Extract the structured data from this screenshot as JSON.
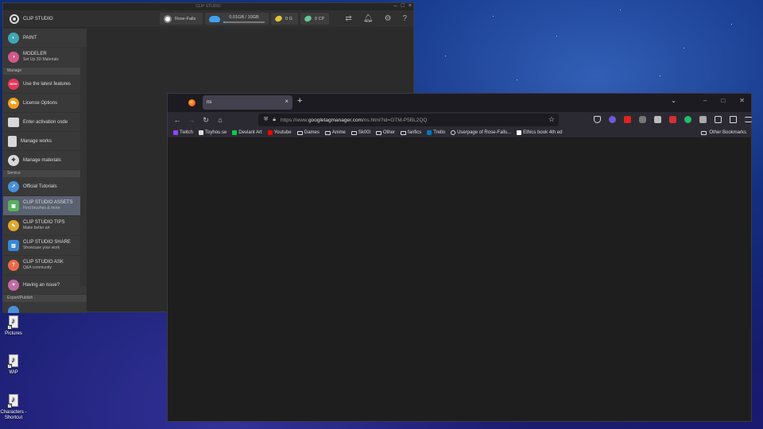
{
  "desktop": {
    "icons": [
      {
        "label": "Pictures"
      },
      {
        "label": "WIP"
      },
      {
        "label": "Characters - Shortcut"
      }
    ]
  },
  "clip": {
    "window_title": "CLIP STUDIO",
    "brand": "CLIP STUDIO",
    "user": "Rose-Falls",
    "storage": "0.01GB / 10GB",
    "storage_fraction": 0.04,
    "gold": "0 G",
    "cp": "0 CP",
    "sections": {
      "manage": "Manage",
      "service": "Service",
      "export": "Export/Publish"
    },
    "items": {
      "paint": "PAINT",
      "modeler": "MODELER",
      "modeler_sub": "Set Up 3D Materials",
      "latest": "Use the latest features",
      "license": "License Options",
      "activation": "Enter activation code",
      "works": "Manage works",
      "materials": "Manage materials",
      "tutorials": "Official Tutorials",
      "assets": "CLIP STUDIO ASSETS",
      "assets_sub": "Find brushes & more",
      "tips": "CLIP STUDIO TIPS",
      "tips_sub": "Make better art",
      "share": "CLIP STUDIO SHARE",
      "share_sub": "Showcase your work",
      "ask": "CLIP STUDIO ASK",
      "ask_sub": "Q&A community",
      "issue": "Having an issue?"
    },
    "new_badge": "NEW"
  },
  "firefox": {
    "tab_title": "ns",
    "url_prefix": "https://www.",
    "url_host": "googletagmanager.com",
    "url_path": "/ns.html?id=GTM-P5BL2QQ",
    "bookmarks": [
      "Twitch",
      "Toyhou.se",
      "Deviant Art",
      "Youtube",
      "Games",
      "Anime",
      "Sk00l",
      "Other",
      "fanfics",
      "Trello",
      "Userpage of Rose-Falls...",
      "Ethics book 4th ed"
    ],
    "other_bookmarks": "Other Bookmarks"
  },
  "colors": {
    "ff_bg": "#1c1b22",
    "ff_toolbar": "#2b2a33",
    "clip_active": "#5a6170",
    "cloud_blue": "#3fa2f0"
  }
}
